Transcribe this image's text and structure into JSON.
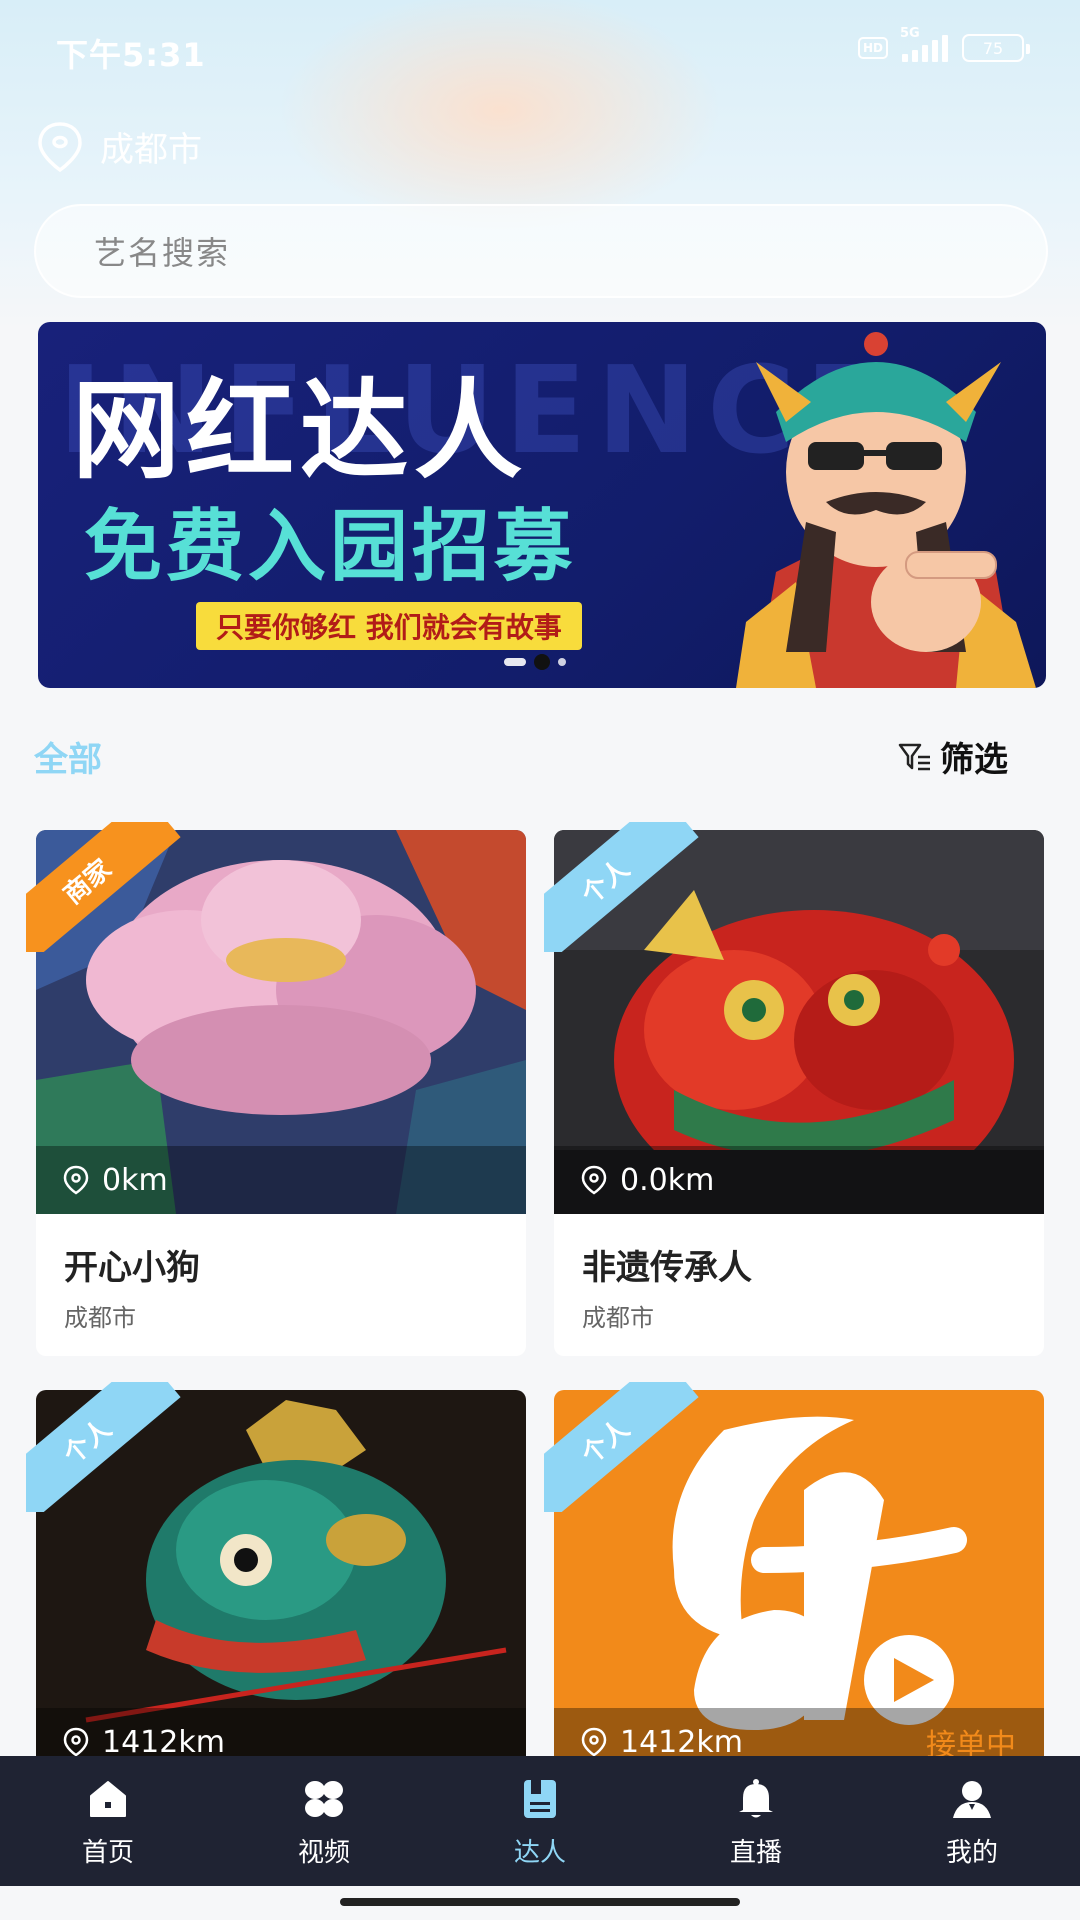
{
  "status_bar": {
    "time": "下午5:31",
    "hd": "HD",
    "network": "5G",
    "battery": "75"
  },
  "location": {
    "city": "成都市",
    "icon": "location-pin-icon"
  },
  "search": {
    "placeholder": "艺名搜索"
  },
  "banner": {
    "background_text": "INFLUENCE",
    "title": "网红达人",
    "subtitle": "免费入园招募",
    "tagline": "只要你够红 我们就会有故事",
    "dots": 3,
    "active_dot": 2
  },
  "filter": {
    "tab_all": "全部",
    "filter_label": "筛选",
    "icon": "filter-icon"
  },
  "cards": [
    {
      "badge": "商家",
      "badge_color": "#f7921e",
      "distance": "0km",
      "name": "开心小狗",
      "city": "成都市",
      "status": ""
    },
    {
      "badge": "个人",
      "badge_color": "#8fd6f5",
      "distance": "0.0km",
      "name": "非遗传承人",
      "city": "成都市",
      "status": ""
    },
    {
      "badge": "个人",
      "badge_color": "#8fd6f5",
      "distance": "1412km",
      "name": "",
      "city": "",
      "status": ""
    },
    {
      "badge": "个人",
      "badge_color": "#8fd6f5",
      "distance": "1412km",
      "name": "",
      "city": "",
      "status": "接单中"
    }
  ],
  "bottom_nav": [
    {
      "label": "首页",
      "icon": "home-icon",
      "active": false
    },
    {
      "label": "视频",
      "icon": "video-grid-icon",
      "active": false
    },
    {
      "label": "达人",
      "icon": "talent-book-icon",
      "active": true
    },
    {
      "label": "直播",
      "icon": "bell-icon",
      "active": false
    },
    {
      "label": "我的",
      "icon": "user-icon",
      "active": false
    }
  ],
  "colors": {
    "accent": "#8fd6f5",
    "merchant_badge": "#f7921e",
    "status_orange": "#f28a1a",
    "nav_bg": "#1f2333"
  }
}
